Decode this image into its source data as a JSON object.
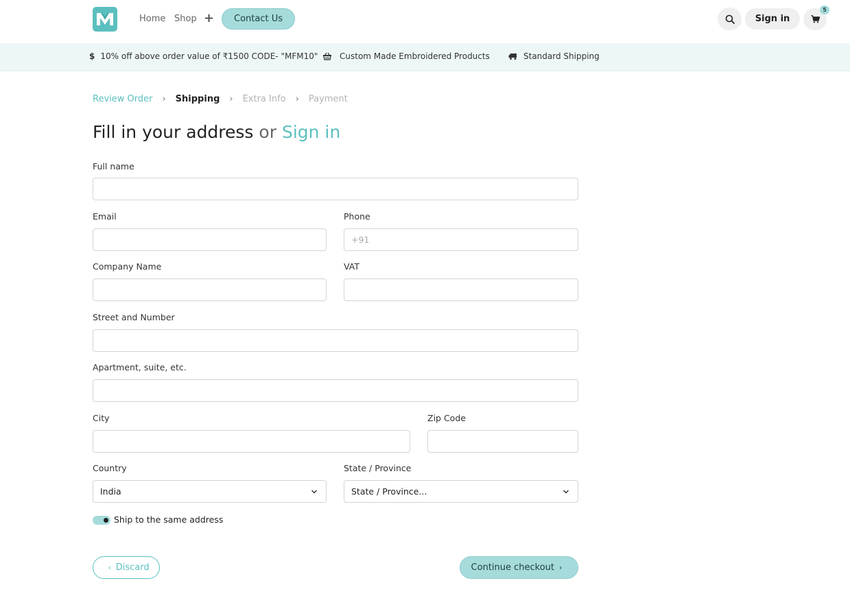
{
  "header": {
    "nav": {
      "home": "Home",
      "shop": "Shop",
      "plus": "+"
    },
    "contact_label": "Contact Us",
    "signin_label": "Sign in",
    "cart_count": "5"
  },
  "promo": {
    "items": [
      {
        "icon": "dollar-icon",
        "text": "10% off above order value of ₹1500  CODE- \"MFM10\""
      },
      {
        "icon": "basket-icon",
        "text": "Custom Made Embroidered Products"
      },
      {
        "icon": "truck-icon",
        "text": "Standard Shipping"
      }
    ]
  },
  "breadcrumb": {
    "steps": [
      "Review Order",
      "Shipping",
      "Extra Info",
      "Payment"
    ]
  },
  "title": {
    "main": "Fill in your address",
    "or": "or",
    "signin": "Sign in"
  },
  "form": {
    "full_name": {
      "label": "Full name",
      "value": "",
      "placeholder": ""
    },
    "email": {
      "label": "Email",
      "value": "",
      "placeholder": ""
    },
    "phone": {
      "label": "Phone",
      "value": "",
      "placeholder": "+91"
    },
    "company": {
      "label": "Company Name",
      "value": "",
      "placeholder": ""
    },
    "vat": {
      "label": "VAT",
      "value": "",
      "placeholder": ""
    },
    "street": {
      "label": "Street and Number",
      "value": "",
      "placeholder": ""
    },
    "apartment": {
      "label": "Apartment, suite, etc.",
      "value": "",
      "placeholder": ""
    },
    "city": {
      "label": "City",
      "value": "",
      "placeholder": ""
    },
    "zip": {
      "label": "Zip Code",
      "value": "",
      "placeholder": ""
    },
    "country": {
      "label": "Country",
      "value": "India"
    },
    "state": {
      "label": "State / Province",
      "value": "State / Province..."
    },
    "same_address": {
      "label": "Ship to the same address",
      "checked": true
    }
  },
  "actions": {
    "discard": "Discard",
    "continue": "Continue checkout"
  },
  "colors": {
    "accent": "#5cbfbf",
    "accent_light": "#a6dbdb",
    "promo_bg": "#edf7f7"
  }
}
